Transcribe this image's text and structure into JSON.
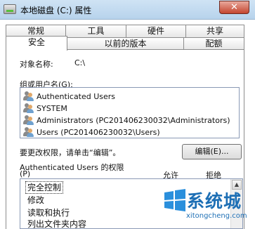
{
  "window": {
    "title": "本地磁盘 (C:) 属性",
    "close_label": "✕"
  },
  "tabs_row1": [
    "常规",
    "工具",
    "硬件",
    "共享"
  ],
  "tabs_row2": [
    "安全",
    "以前的版本",
    "配额"
  ],
  "object_name_label": "对象名称:",
  "object_name_value": "C:\\",
  "groups_label": "组或用户名(G):",
  "groups": [
    "Authenticated Users",
    "SYSTEM",
    "Administrators (PC201406230032\\Administrators)",
    "Users (PC201406230032\\Users)"
  ],
  "edit_hint": "要更改权限，请单击“编辑”。",
  "edit_button": "编辑(E)...",
  "permissions_label_line1": "Authenticated Users 的权限",
  "permissions_label_line2": "(P)",
  "allow_header": "允许",
  "deny_header": "拒绝",
  "permissions": [
    "完全控制",
    "修改",
    "读取和执行",
    "列出文件夹内容"
  ],
  "watermark": {
    "text": "系统城",
    "url": "xitongcheng.com"
  }
}
